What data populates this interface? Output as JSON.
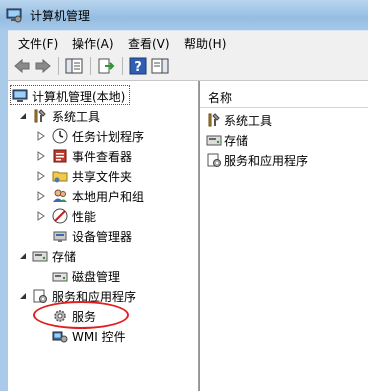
{
  "window": {
    "title": "计算机管理"
  },
  "menu": [
    "文件(F)",
    "操作(A)",
    "查看(V)",
    "帮助(H)"
  ],
  "tree": {
    "root": "计算机管理(本地)",
    "system_tools": "系统工具",
    "task_scheduler": "任务计划程序",
    "event_viewer": "事件查看器",
    "shared_folders": "共享文件夹",
    "local_users": "本地用户和组",
    "performance": "性能",
    "device_manager": "设备管理器",
    "storage": "存储",
    "disk_management": "磁盘管理",
    "services_apps": "服务和应用程序",
    "services": "服务",
    "wmi": "WMI 控件"
  },
  "right_pane": {
    "column_header": "名称",
    "items": [
      "系统工具",
      "存储",
      "服务和应用程序"
    ]
  },
  "colors": {
    "highlight_ring": "#e02020",
    "title_bar": "#94bde2"
  }
}
